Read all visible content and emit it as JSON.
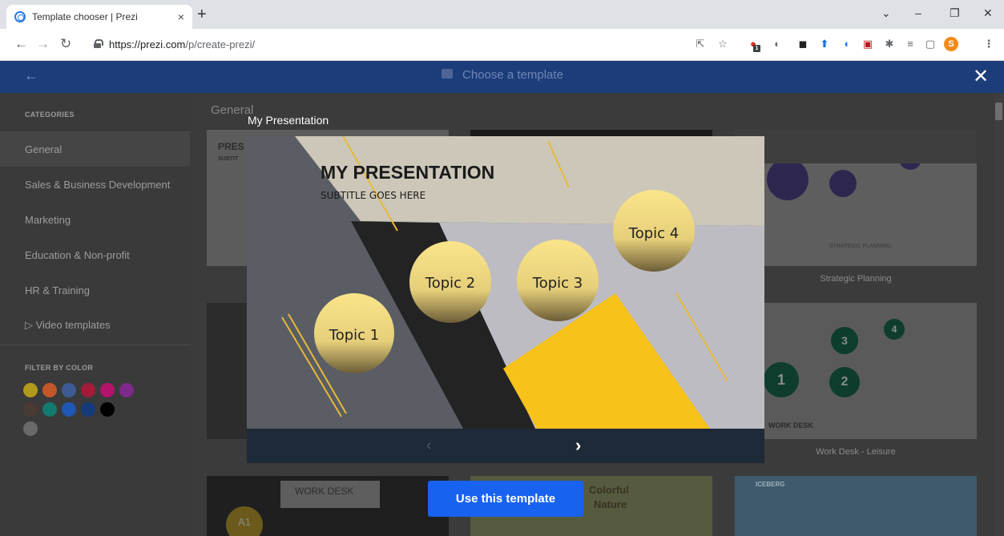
{
  "browser": {
    "tab_title": "Template chooser | Prezi",
    "tab_close": "×",
    "new_tab": "+",
    "url_domain": "https://prezi.com",
    "url_path": "/p/create-prezi/",
    "profile_initial": "S",
    "ext_badge": "1"
  },
  "header": {
    "title": "Choose a template",
    "back_icon": "arrow-left-icon",
    "close_icon": "close-icon"
  },
  "sidebar": {
    "categories_heading": "CATEGORIES",
    "items": [
      {
        "label": "General",
        "active": true
      },
      {
        "label": "Sales & Business Development",
        "active": false
      },
      {
        "label": "Marketing",
        "active": false
      },
      {
        "label": "Education & Non-profit",
        "active": false
      },
      {
        "label": "HR & Training",
        "active": false
      },
      {
        "label": "▷ Video templates",
        "active": false
      }
    ],
    "filter_heading": "FILTER BY COLOR",
    "colors": [
      "#b09a1c",
      "#c4572a",
      "#3c5b94",
      "#a41b3a",
      "#b3136a",
      "#7d2a8a",
      "#4a3a34",
      "#127a6e",
      "#1f57b5",
      "#153a7a",
      "#000000",
      "#3a3a3a",
      "#6a6a6a"
    ]
  },
  "main": {
    "section_title": "General",
    "cards": [
      {
        "label": ""
      },
      {
        "label": ""
      },
      {
        "label": "Strategic Planning"
      },
      {
        "label": ""
      },
      {
        "label": ""
      },
      {
        "label": "Work Desk - Leisure"
      },
      {
        "label": ""
      },
      {
        "label": ""
      },
      {
        "label": ""
      }
    ],
    "card_texts": {
      "pres": "PRES",
      "subtitle_short": "SUBTIT",
      "strategic": "STRATEGIC PLANNING",
      "work_desk": "WORK DESK",
      "work_desk2": "WORK DESK",
      "colorful": "Colorful",
      "nature": "Nature",
      "iceberg": "ICEBERG",
      "a1": "A1",
      "num1": "1",
      "num2": "2",
      "num3": "3",
      "num4": "4"
    }
  },
  "modal": {
    "title": "My Presentation",
    "slide_title": "MY PRESENTATION",
    "slide_subtitle": "SUBTITLE GOES HERE",
    "topics": [
      "Topic 1",
      "Topic 2",
      "Topic 3",
      "Topic 4"
    ],
    "prev_icon": "‹",
    "next_icon": "›",
    "use_button": "Use this template"
  },
  "colors": {
    "header_bg": "#1c3d7a",
    "primary_button": "#1862f0",
    "slide_yellow": "#f7c21a"
  }
}
